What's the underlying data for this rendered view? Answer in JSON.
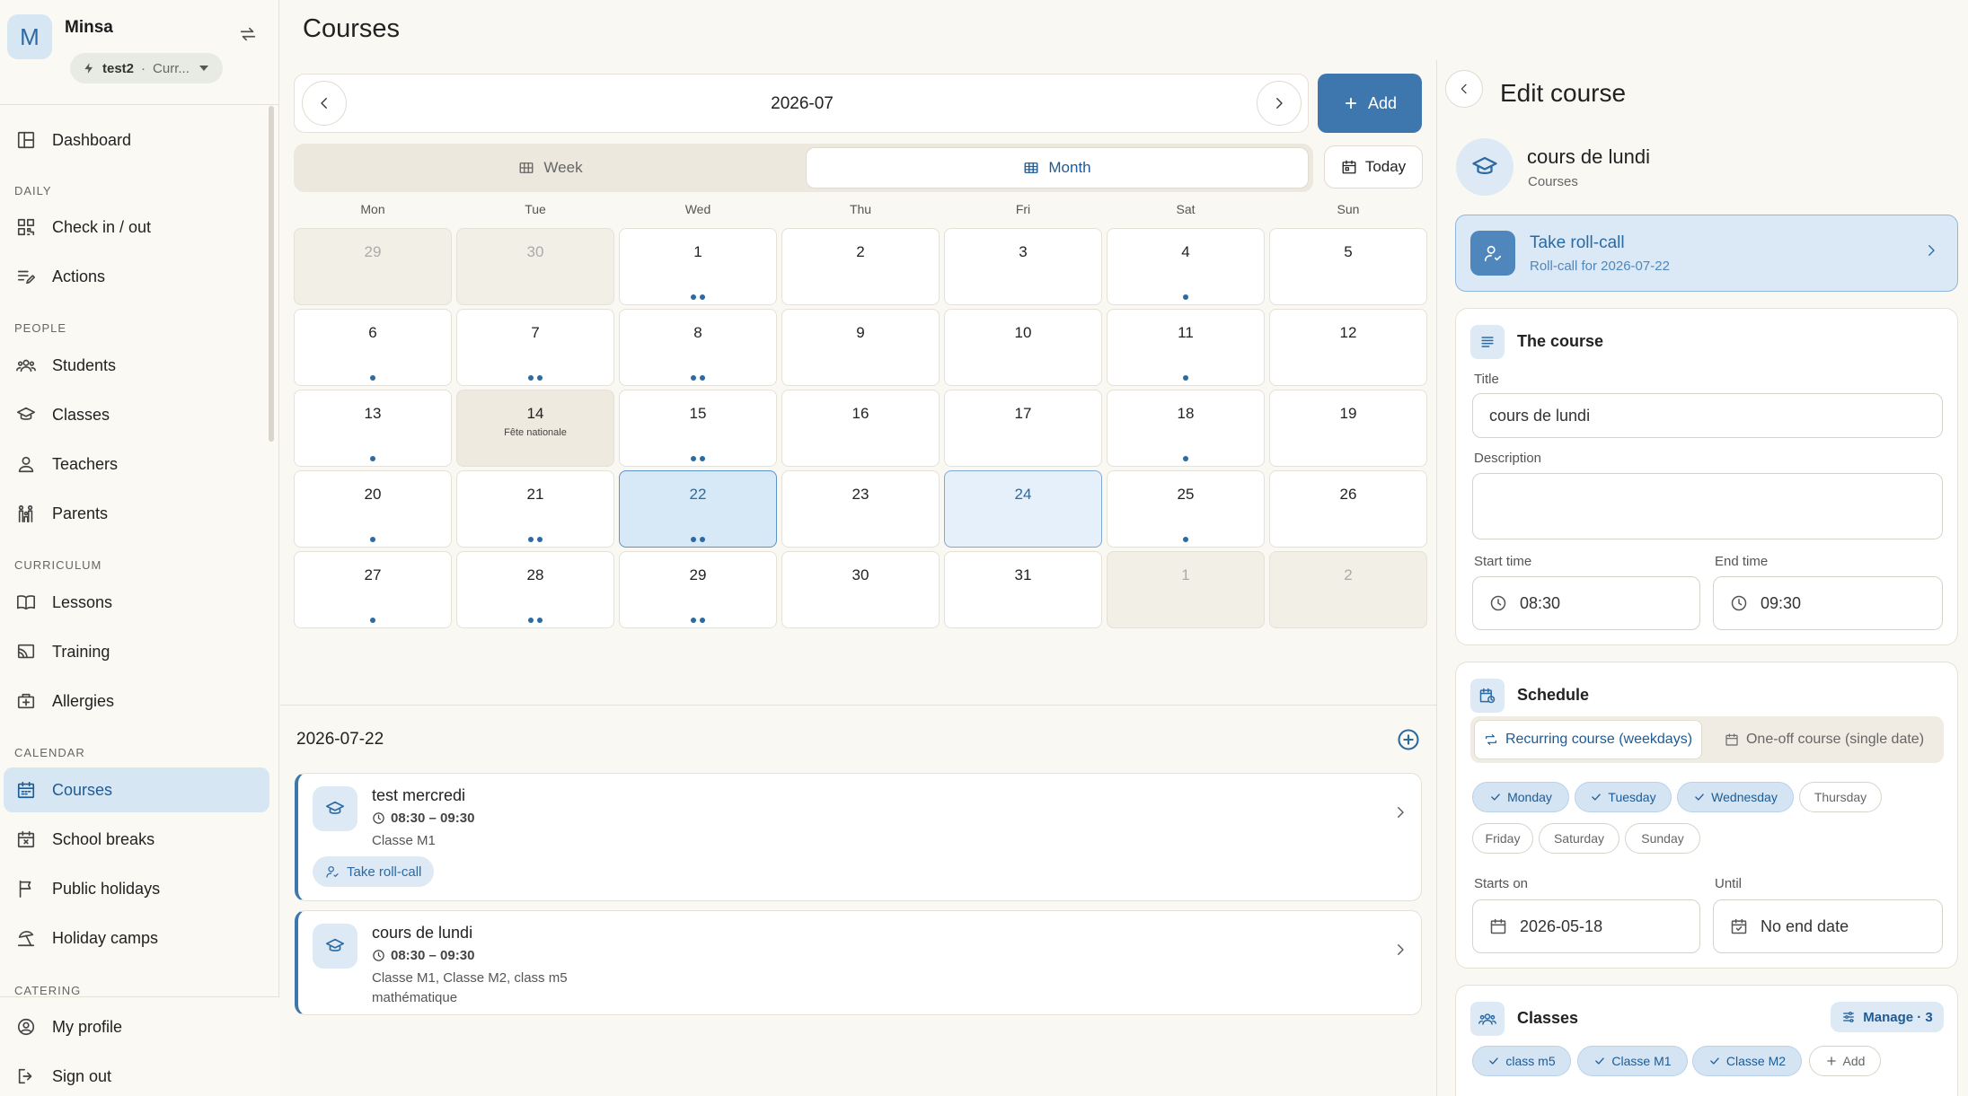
{
  "user": {
    "initial": "M",
    "name": "Minsa",
    "tenant": "test2",
    "tenant_sep": "·",
    "tenant_sub": "Curr..."
  },
  "nav": {
    "dashboard": "Dashboard",
    "sec_daily": "DAILY",
    "checkin": "Check in / out",
    "actions": "Actions",
    "sec_people": "PEOPLE",
    "students": "Students",
    "classes": "Classes",
    "teachers": "Teachers",
    "parents": "Parents",
    "sec_curriculum": "CURRICULUM",
    "lessons": "Lessons",
    "training": "Training",
    "allergies": "Allergies",
    "sec_calendar": "CALENDAR",
    "courses": "Courses",
    "school_breaks": "School breaks",
    "public_holidays": "Public holidays",
    "holiday_camps": "Holiday camps",
    "sec_catering": "CATERING",
    "my_profile": "My profile",
    "sign_out": "Sign out"
  },
  "page": {
    "title": "Courses"
  },
  "calendar": {
    "month_label": "2026-07",
    "add_label": "Add",
    "week_label": "Week",
    "month_view_label": "Month",
    "today_label": "Today",
    "weekdays": [
      "Mon",
      "Tue",
      "Wed",
      "Thu",
      "Fri",
      "Sat",
      "Sun"
    ],
    "days": [
      {
        "n": "29",
        "state": "out",
        "dots": 0
      },
      {
        "n": "30",
        "state": "out",
        "dots": 0
      },
      {
        "n": "1",
        "dots": 2
      },
      {
        "n": "2",
        "dots": 0
      },
      {
        "n": "3",
        "dots": 0
      },
      {
        "n": "4",
        "dots": 1
      },
      {
        "n": "5",
        "dots": 0
      },
      {
        "n": "6",
        "dots": 1
      },
      {
        "n": "7",
        "dots": 2
      },
      {
        "n": "8",
        "dots": 2
      },
      {
        "n": "9",
        "dots": 0
      },
      {
        "n": "10",
        "dots": 0
      },
      {
        "n": "11",
        "dots": 1
      },
      {
        "n": "12",
        "dots": 0
      },
      {
        "n": "13",
        "dots": 1
      },
      {
        "n": "14",
        "state": "holiday",
        "note": "Fête nationale",
        "dots": 0
      },
      {
        "n": "15",
        "dots": 2
      },
      {
        "n": "16",
        "dots": 0
      },
      {
        "n": "17",
        "dots": 0
      },
      {
        "n": "18",
        "dots": 1
      },
      {
        "n": "19",
        "dots": 0
      },
      {
        "n": "20",
        "dots": 1
      },
      {
        "n": "21",
        "dots": 2
      },
      {
        "n": "22",
        "state": "sel",
        "dots": 2
      },
      {
        "n": "23",
        "dots": 0
      },
      {
        "n": "24",
        "state": "today",
        "dots": 0
      },
      {
        "n": "25",
        "dots": 1
      },
      {
        "n": "26",
        "dots": 0
      },
      {
        "n": "27",
        "dots": 1
      },
      {
        "n": "28",
        "dots": 2
      },
      {
        "n": "29",
        "dots": 2
      },
      {
        "n": "30",
        "dots": 0
      },
      {
        "n": "31",
        "dots": 0
      },
      {
        "n": "1",
        "state": "out",
        "dots": 0
      },
      {
        "n": "2",
        "state": "out",
        "dots": 0
      }
    ]
  },
  "day_list": {
    "date": "2026-07-22",
    "events": [
      {
        "title": "test mercredi",
        "time": "08:30 – 09:30",
        "meta": "Classe M1",
        "meta2": "",
        "rollcall": "Take roll-call"
      },
      {
        "title": "cours de lundi",
        "time": "08:30 – 09:30",
        "meta": "Classe M1, Classe M2, class m5",
        "meta2": "mathématique",
        "rollcall": ""
      }
    ]
  },
  "panel": {
    "title": "Edit course",
    "course_name": "cours de lundi",
    "course_sub": "Courses",
    "rollcall_title": "Take roll-call",
    "rollcall_sub": "Roll-call for 2026-07-22",
    "course_card": {
      "title": "The course",
      "title_label": "Title",
      "title_value": "cours de lundi",
      "desc_label": "Description",
      "desc_value": "",
      "start_label": "Start time",
      "start_value": "08:30",
      "end_label": "End time",
      "end_value": "09:30"
    },
    "schedule": {
      "title": "Schedule",
      "recurring": "Recurring course (weekdays)",
      "oneoff": "One-off course (single date)",
      "days": [
        {
          "label": "Monday",
          "on": true
        },
        {
          "label": "Tuesday",
          "on": true
        },
        {
          "label": "Wednesday",
          "on": true
        },
        {
          "label": "Thursday",
          "on": false
        },
        {
          "label": "Friday",
          "on": false
        },
        {
          "label": "Saturday",
          "on": false
        },
        {
          "label": "Sunday",
          "on": false
        }
      ],
      "starts_label": "Starts on",
      "starts_value": "2026-05-18",
      "until_label": "Until",
      "until_value": "No end date"
    },
    "classes": {
      "title": "Classes",
      "manage": "Manage · 3",
      "chips": [
        "class m5",
        "Classe M1",
        "Classe M2"
      ],
      "add": "Add"
    }
  },
  "colors": {
    "accent": "#3d77ad",
    "selected_day": "#d7e8f6",
    "sidebar_active": "#d7e6f3"
  }
}
